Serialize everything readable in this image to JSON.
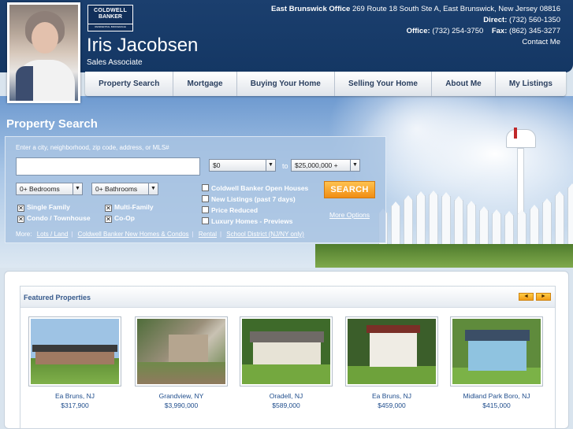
{
  "header": {
    "agent_name": "Iris Jacobsen",
    "agent_title": "Sales Associate",
    "logo": {
      "line1": "COLDWELL",
      "line2": "BANKER",
      "line3": "RESIDENTIAL BROKERAGE"
    },
    "office_label": "East Brunswick Office",
    "office_address": "269 Route 18 South Ste A, East Brunswick, New Jersey 08816",
    "direct_label": "Direct:",
    "direct_phone": "(732) 560-1350",
    "office_phone_label": "Office:",
    "office_phone": "(732) 254-3750",
    "fax_label": "Fax:",
    "fax_phone": "(862) 345-3277",
    "contact_link": "Contact Me"
  },
  "nav": {
    "items": [
      "Property Search",
      "Mortgage",
      "Buying Your Home",
      "Selling Your Home",
      "About Me",
      "My Listings"
    ]
  },
  "search": {
    "title": "Property Search",
    "hint": "Enter a city, neighborhood, zip code, address, or MLS#",
    "input_value": "",
    "price_min": "$0",
    "price_to": "to",
    "price_max": "$25,000,000 +",
    "bedrooms": "0+ Bedrooms",
    "bathrooms": "0+ Bathrooms",
    "types": [
      {
        "label": "Single Family",
        "checked": true
      },
      {
        "label": "Multi-Family",
        "checked": true
      },
      {
        "label": "Condo / Townhouse",
        "checked": true
      },
      {
        "label": "Co-Op",
        "checked": true
      }
    ],
    "filters": [
      {
        "label": "Coldwell Banker Open Houses",
        "checked": false
      },
      {
        "label": "New Listings (past 7 days)",
        "checked": false
      },
      {
        "label": "Price Reduced",
        "checked": false
      },
      {
        "label": "Luxury Homes - Previews",
        "checked": false
      }
    ],
    "search_button": "SEARCH",
    "more_options": "More Options",
    "more_label": "More:",
    "more_links": [
      "Lots / Land",
      "Coldwell Banker New Homes & Condos",
      "Rental",
      "School District (NJ/NY only)"
    ]
  },
  "featured": {
    "title": "Featured Properties",
    "prev_icon": "◄",
    "next_icon": "►",
    "properties": [
      {
        "location": "Ea Bruns, NJ",
        "price": "$317,900"
      },
      {
        "location": "Grandview, NY",
        "price": "$3,990,000"
      },
      {
        "location": "Oradell, NJ",
        "price": "$589,000"
      },
      {
        "location": "Ea Bruns, NJ",
        "price": "$459,000"
      },
      {
        "location": "Midland Park Boro, NJ",
        "price": "$415,000"
      }
    ]
  }
}
